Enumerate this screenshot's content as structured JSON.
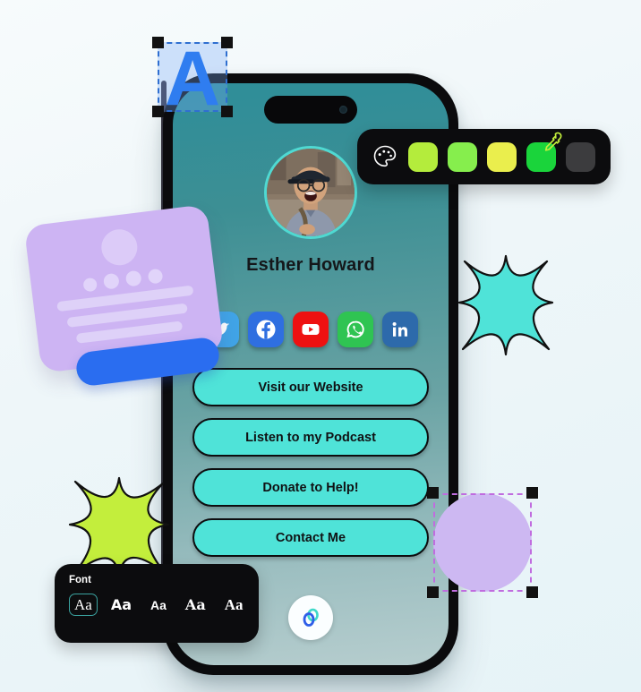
{
  "canvas": {
    "background_color": "#eef6f9"
  },
  "selected_text_element": {
    "glyph": "A",
    "color": "#2f7df0",
    "selection_color": "#2f6fd0",
    "name": "letter-a-element"
  },
  "selected_shape_element": {
    "shape": "circle",
    "color": "#cdb8f2",
    "selection_color": "#c06cdf"
  },
  "palette_toolbar": {
    "icon": "palette-icon",
    "eyedropper_icon": "eyedropper-icon",
    "swatches": [
      {
        "name": "swatch-yellow-green",
        "color": "#b4ec3c"
      },
      {
        "name": "swatch-lime",
        "color": "#86ee4d"
      },
      {
        "name": "swatch-yellow",
        "color": "#eaee4d"
      },
      {
        "name": "swatch-green",
        "color": "#1ad43b"
      },
      {
        "name": "swatch-dark-gray",
        "color": "#3c3c3e"
      }
    ],
    "active_swatch_index": 3
  },
  "font_toolbar": {
    "label": "Font",
    "options": [
      {
        "sample": "Aa",
        "selected": true
      },
      {
        "sample": "Aa",
        "selected": false
      },
      {
        "sample": "Aa",
        "selected": false
      },
      {
        "sample": "Aa",
        "selected": false
      },
      {
        "sample": "Aa",
        "selected": false
      }
    ],
    "selected_outline_color": "#3ba3a0"
  },
  "phone": {
    "notch": "dynamic-island",
    "screen_background": "teal-gradient",
    "profile": {
      "avatar_alt": "profile-photo",
      "avatar_ring_color": "#4fd9d2",
      "name": "Esther Howard"
    },
    "social_links": [
      {
        "name": "twitter",
        "label": "Twitter",
        "color": "#41a5e8"
      },
      {
        "name": "facebook",
        "label": "Facebook",
        "color": "#2f6fe0"
      },
      {
        "name": "youtube",
        "label": "YouTube",
        "color": "#ee1111"
      },
      {
        "name": "whatsapp",
        "label": "WhatsApp",
        "color": "#2fc452"
      },
      {
        "name": "linkedin",
        "label": "LinkedIn",
        "color": "#2d6aab"
      }
    ],
    "link_buttons": [
      {
        "label": "Visit our Website"
      },
      {
        "label": "Listen to my Podcast"
      },
      {
        "label": "Donate to Help!"
      },
      {
        "label": "Contact Me"
      }
    ],
    "link_button_color": "#4fe3d8",
    "brand_badge": "linked-rings-logo"
  },
  "decorations": {
    "sparkle_teal_color": "#4fe3d8",
    "sparkle_green_color": "#c3ee3c",
    "card_color": "#cdb4f3",
    "card_button_color": "#2a6df0"
  }
}
